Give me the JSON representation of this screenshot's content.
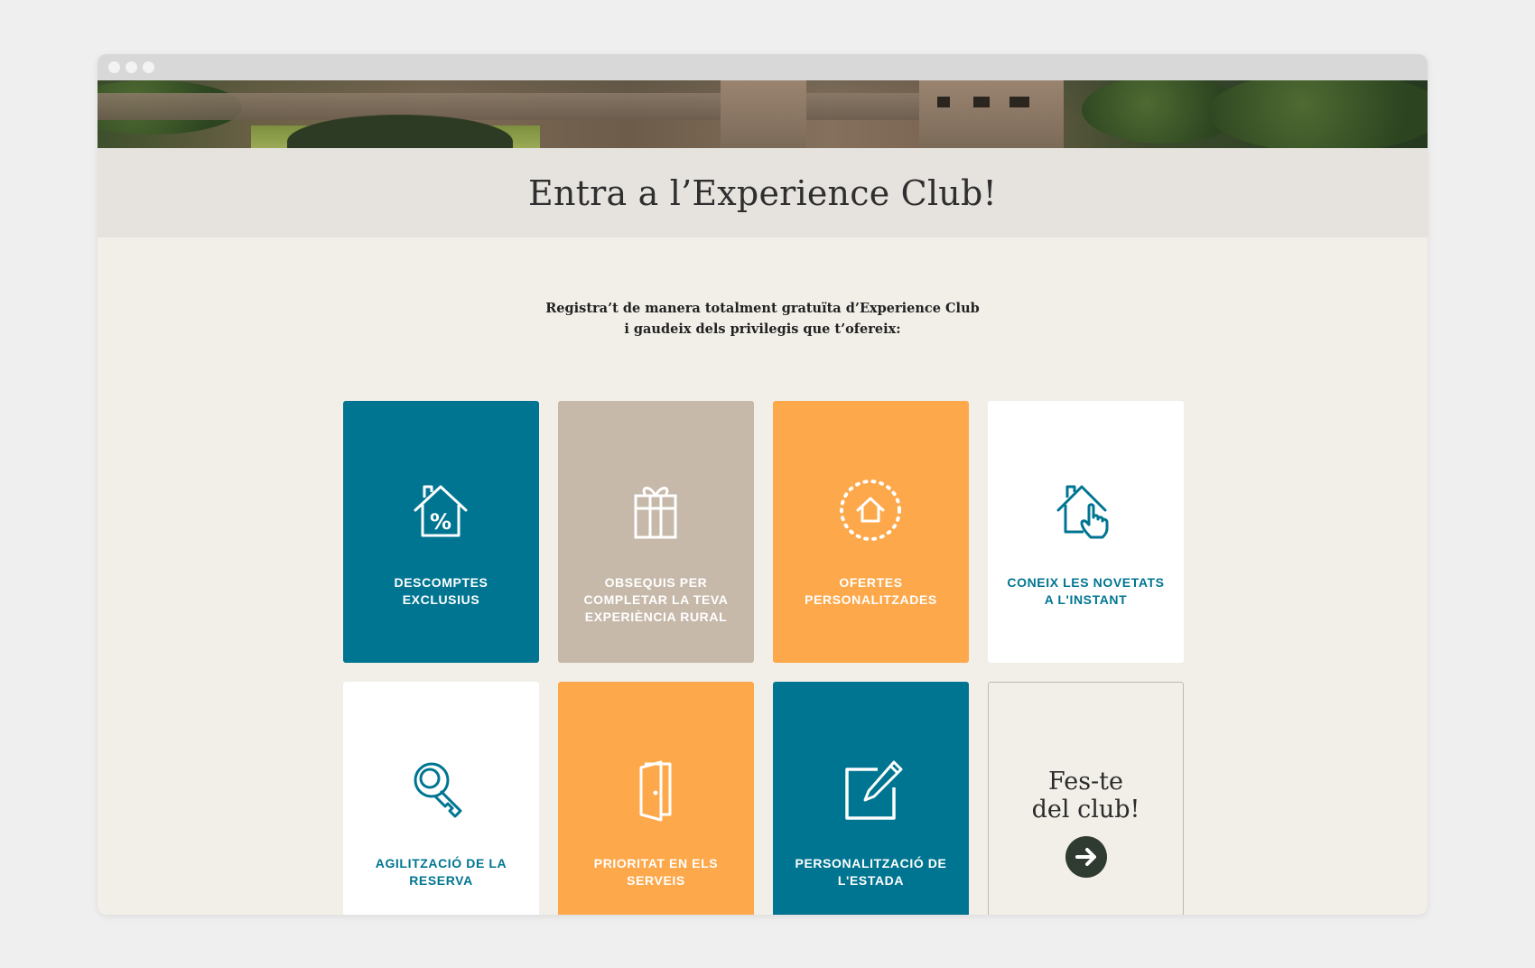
{
  "page": {
    "title": "Entra a l’Experience Club!",
    "intro_line1": "Registra’t de manera totalment gratuïta d’Experience Club",
    "intro_line2": "i gaudeix dels privilegis que t’ofereix:"
  },
  "colors": {
    "teal": "#007591",
    "beige": "#c6b9aa",
    "orange": "#fda84a",
    "white": "#ffffff",
    "background": "#f2efe9",
    "title_band": "#e6e3de"
  },
  "cards": [
    {
      "label_line1": "DESCOMPTES",
      "label_line2": "EXCLUSIUS",
      "label_line3": "",
      "icon": "house-percent-icon",
      "color": "teal"
    },
    {
      "label_line1": "OBSEQUIS PER",
      "label_line2": "COMPLETAR LA TEVA",
      "label_line3": "EXPERIÈNCIA RURAL",
      "icon": "gift-icon",
      "color": "beige"
    },
    {
      "label_line1": "OFERTES",
      "label_line2": "PERSONALITZADES",
      "label_line3": "",
      "icon": "house-circle-icon",
      "color": "orange"
    },
    {
      "label_line1": "CONEIX LES NOVETATS",
      "label_line2": "A L'INSTANT",
      "label_line3": "",
      "icon": "house-hand-icon",
      "color": "white"
    },
    {
      "label_line1": "AGILITZACIÓ DE LA",
      "label_line2": "RESERVA",
      "label_line3": "",
      "icon": "key-icon",
      "color": "white"
    },
    {
      "label_line1": "PRIORITAT EN ELS",
      "label_line2": "SERVEIS",
      "label_line3": "",
      "icon": "door-icon",
      "color": "orange"
    },
    {
      "label_line1": "PERSONALITZACIÓ DE",
      "label_line2": "L'ESTADA",
      "label_line3": "",
      "icon": "pencil-square-icon",
      "color": "teal"
    }
  ],
  "cta": {
    "line1": "Fes-te",
    "line2": "del club!",
    "icon": "arrow-right-icon"
  }
}
